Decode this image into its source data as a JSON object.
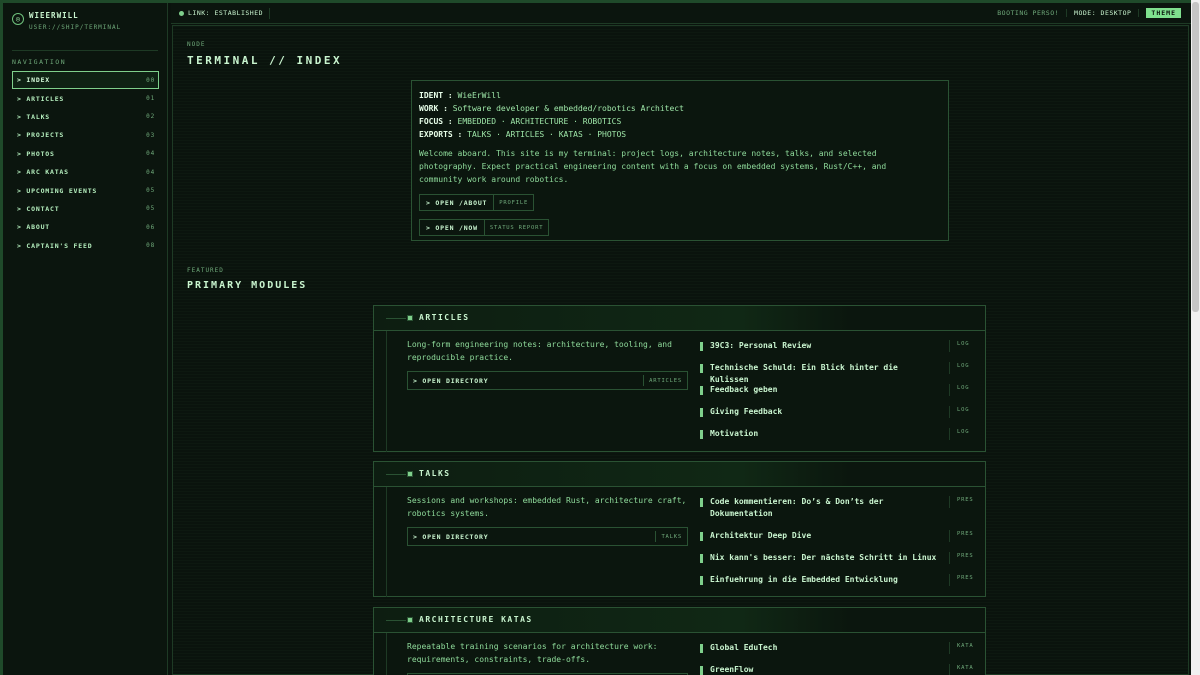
{
  "brand": {
    "icon": "target-icon",
    "name": "WIEERWILL",
    "sub": "USER://SHIP/TERMINAL"
  },
  "sidebar": {
    "title": "NAVIGATION",
    "items": [
      {
        "label": "> INDEX",
        "num": "00",
        "active": true
      },
      {
        "label": "> ARTICLES",
        "num": "01"
      },
      {
        "label": "> TALKS",
        "num": "02"
      },
      {
        "label": "> PROJECTS",
        "num": "03"
      },
      {
        "label": "> PHOTOS",
        "num": "04"
      },
      {
        "label": "> ARC KATAS",
        "num": "04"
      },
      {
        "label": "> UPCOMING EVENTS",
        "num": "05"
      },
      {
        "label": "> CONTACT",
        "num": "05"
      },
      {
        "label": "> ABOUT",
        "num": "06"
      },
      {
        "label": "> CAPTAIN'S FEED",
        "num": "08"
      }
    ]
  },
  "topbar": {
    "link": "LINK: ESTABLISHED",
    "boot": "BOOTING PERSO!",
    "mode": "MODE: DESKTOP",
    "theme": "THEME"
  },
  "main": {
    "node": "NODE",
    "title": "TERMINAL // INDEX",
    "ident": {
      "rows": [
        {
          "k": "IDENT :",
          "v": " WieErWill"
        },
        {
          "k": "WORK :",
          "v": " Software developer & embedded/robotics Architect"
        },
        {
          "k": "FOCUS :",
          "v": " EMBEDDED · ARCHITECTURE · ROBOTICS"
        },
        {
          "k": "EXPORTS :",
          "v": " TALKS · ARTICLES · KATAS · PHOTOS"
        }
      ],
      "welcome": "Welcome aboard. This site is my terminal: project logs, architecture notes, talks, and selected photography. Expect practical engineering content with a focus on embedded systems, Rust/C++, and community work around robotics.",
      "buttons": [
        {
          "label": ">  OPEN /ABOUT",
          "tag": "PROFILE"
        },
        {
          "label": ">  OPEN /NOW",
          "tag": "STATUS REPORT"
        }
      ]
    },
    "featured_label": "FEATURED",
    "featured_title": "PRIMARY MODULES",
    "modules": [
      {
        "title": "ARTICLES",
        "desc": "Long-form engineering notes: architecture, tooling, and reproducible practice.",
        "button": ">  OPEN DIRECTORY",
        "button_tag": "ARTICLES",
        "entries": [
          {
            "text": "39C3: Personal Review",
            "kind": "LOG"
          },
          {
            "text": "Technische Schuld: Ein Blick hinter die Kulissen",
            "kind": "LOG"
          },
          {
            "text": "Feedback geben",
            "kind": "LOG"
          },
          {
            "text": "Giving Feedback",
            "kind": "LOG"
          },
          {
            "text": "Motivation",
            "kind": "LOG"
          }
        ]
      },
      {
        "title": "TALKS",
        "desc": "Sessions and workshops: embedded Rust, architecture craft, robotics systems.",
        "button": ">  OPEN DIRECTORY",
        "button_tag": "TALKS",
        "entries": [
          {
            "text": "Code kommentieren: Do’s & Don’ts der Dokumentation",
            "kind": "PRES"
          },
          {
            "text": "Architektur Deep Dive",
            "kind": "PRES"
          },
          {
            "text": "Nix kann's besser: Der nächste Schritt in Linux",
            "kind": "PRES"
          },
          {
            "text": "Einfuehrung in die Embedded Entwicklung",
            "kind": "PRES"
          }
        ]
      },
      {
        "title": "ARCHITECTURE KATAS",
        "desc": "Repeatable training scenarios for architecture work: requirements, constraints, trade-offs.",
        "entries": [
          {
            "text": "Global EduTech",
            "kind": "KATA"
          },
          {
            "text": "GreenFlow",
            "kind": "KATA"
          }
        ]
      }
    ]
  }
}
